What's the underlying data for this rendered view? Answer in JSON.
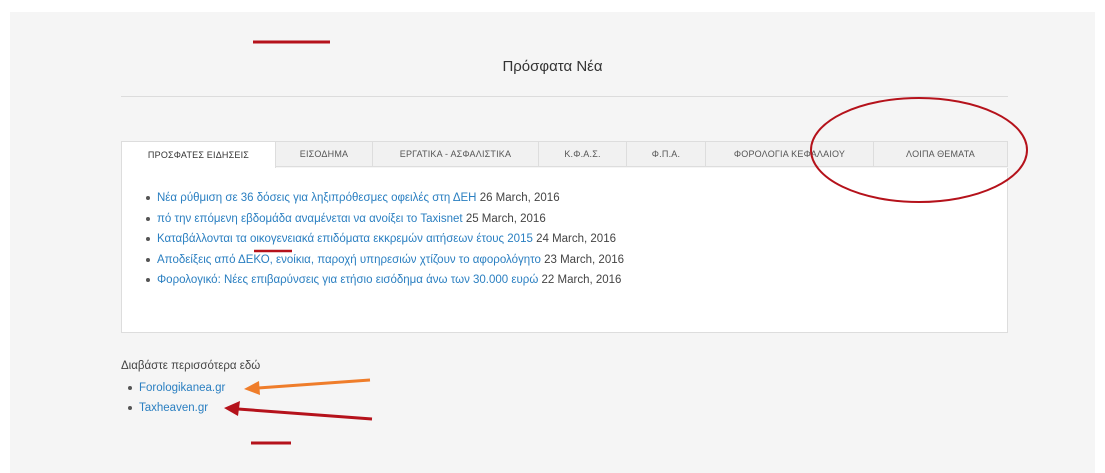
{
  "page": {
    "title": "Πρόσφατα Νέα"
  },
  "tabs": [
    {
      "label": "ΠΡΟΣΦΑΤΕΣ ΕΙΔΗΣΕΙΣ",
      "active": true
    },
    {
      "label": "ΕΙΣΟΔΗΜΑ",
      "active": false
    },
    {
      "label": "ΕΡΓΑΤΙΚΑ - ΑΣΦΑΛΙΣΤΙΚΑ",
      "active": false
    },
    {
      "label": "Κ.Φ.Α.Σ.",
      "active": false
    },
    {
      "label": "Φ.Π.Α.",
      "active": false
    },
    {
      "label": "ΦΟΡΟΛΟΓΙΑ ΚΕΦΑΛΑΙΟΥ",
      "active": false
    },
    {
      "label": "ΛΟΙΠΑ ΘΕΜΑΤΑ",
      "active": false
    }
  ],
  "news": [
    {
      "title": "Νέα ρύθμιση σε 36 δόσεις για ληξιπρόθεσμες οφειλές στη ΔΕΗ",
      "date": "26 March, 2016"
    },
    {
      "title": "πό την επόμενη εβδομάδα αναμένεται να ανοίξει το Taxisnet",
      "date": "25 March, 2016"
    },
    {
      "title": "Καταβάλλονται τα οικογενειακά επιδόματα εκκρεμών αιτήσεων έτους 2015",
      "date": "24 March, 2016"
    },
    {
      "title": "Αποδείξεις από ΔΕΚΟ, ενοίκια, παροχή υπηρεσιών χτίζουν το αφορολόγητο",
      "date": "23 March, 2016"
    },
    {
      "title": "Φορολογικό: Νέες επιβαρύνσεις για ετήσιο εισόδημα άνω των 30.000 ευρώ",
      "date": "22 March, 2016"
    }
  ],
  "more": {
    "label": "Διαβάστε περισσότερα εδώ",
    "links": [
      "Forologikanea.gr",
      "Taxheaven.gr"
    ]
  },
  "annotation_colors": {
    "red": "#b5121b",
    "orange": "#ef7d2a"
  }
}
